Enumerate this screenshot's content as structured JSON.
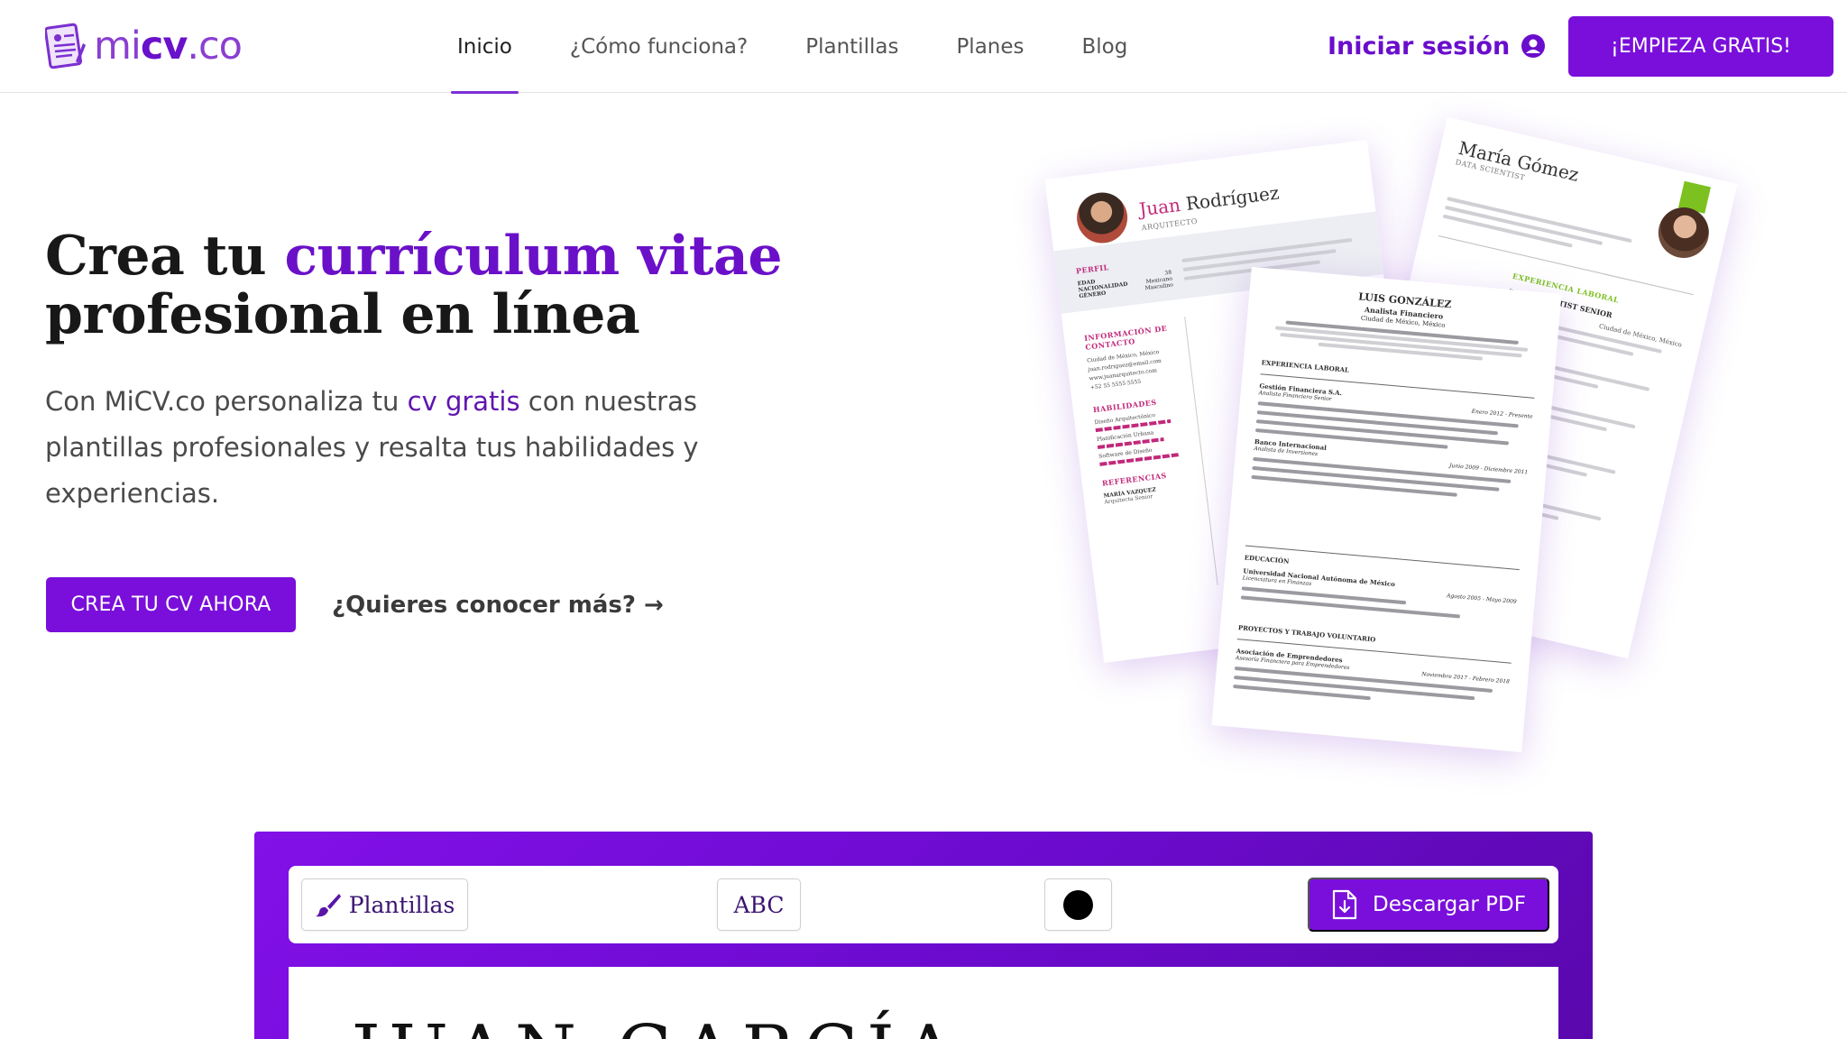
{
  "brand": {
    "logo_regular_1": "mi",
    "logo_bold": "cv",
    "logo_regular_2": ".co",
    "primary_color": "#7a0fdb",
    "accent_color": "#6b10c9"
  },
  "nav": {
    "items": [
      {
        "label": "Inicio",
        "active": true
      },
      {
        "label": "¿Cómo funciona?",
        "active": false
      },
      {
        "label": "Plantillas",
        "active": false
      },
      {
        "label": "Planes",
        "active": false
      },
      {
        "label": "Blog",
        "active": false
      }
    ],
    "login_label": "Iniciar sesión",
    "login_icon": "user-circle-icon",
    "cta_label": "¡EMPIEZA GRATIS!"
  },
  "hero": {
    "title_part1": "Crea tu ",
    "title_accent": "currículum vitae",
    "title_part2": "profesional en línea",
    "subtitle_part1": "Con MiCV.co personaliza tu ",
    "subtitle_link": "cv gratis",
    "subtitle_part2": " con nuestras plantillas profesionales y resalta tus habilidades y experiencias.",
    "primary_button": "CREA TU CV AHORA",
    "secondary_link": "¿Quieres conocer más? →"
  },
  "cv_previews": {
    "juan": {
      "first_name": "Juan",
      "last_name": "Rodríguez",
      "role": "ARQUITECTO",
      "sections": [
        "PERFIL",
        "INFORMACIÓN DE CONTACTO",
        "HABILIDADES",
        "REFERENCIAS"
      ],
      "profile_rows": [
        {
          "label": "EDAD",
          "value": "38"
        },
        {
          "label": "NACIONALIDAD",
          "value": "Mexicano"
        },
        {
          "label": "GÉNERO",
          "value": "Masculino"
        }
      ],
      "contact": [
        "Ciudad de México, México",
        "juan.rodriguez@email.com",
        "www.juanarquitecto.com",
        "+52 55 5555 5555"
      ],
      "skills": [
        "Diseño Arquitectónico",
        "Planificación Urbana",
        "Software de Diseño"
      ],
      "reference_name": "MARÍA VAZQUEZ",
      "reference_role": "Arquitecta Senior",
      "accent_color": "#c2297a"
    },
    "maria": {
      "name": "María Gómez",
      "role": "DATA SCIENTIST",
      "section": "EXPERIENCIA LABORAL",
      "job": "DATA SCIENTIST SENIOR",
      "location": "Ciudad de México, México",
      "accent_color": "#7cc11f"
    },
    "luis": {
      "name": "LUIS GONZÁLEZ",
      "role": "Analista Financiero",
      "location": "Ciudad de México, México",
      "sections": [
        "EXPERIENCIA LABORAL",
        "EDUCACIÓN",
        "PROYECTOS Y TRABAJO VOLUNTARIO"
      ],
      "jobs": [
        {
          "company": "Gestión Financiera S.A.",
          "title": "Analista Financiero Senior",
          "dates": "Enero 2012 - Presente"
        },
        {
          "company": "Banco Internacional",
          "title": "Analista de Inversiones",
          "dates": "Junio 2009 - Diciembre 2011"
        }
      ],
      "education": {
        "school": "Universidad Nacional Autónoma de México",
        "degree": "Licenciatura en Finanzas",
        "dates": "Agosto 2005 - Mayo 2009"
      },
      "project": {
        "name": "Asociación de Emprendedores",
        "role": "Asesoría Financiera para Emprendedores",
        "dates": "Noviembre 2017 - Febrero 2018"
      }
    }
  },
  "editor": {
    "templates_button": "Plantillas",
    "templates_icon": "paintbrush-icon",
    "font_button": "ABC",
    "color_value": "#000000",
    "download_button": "Descargar PDF",
    "download_icon": "file-download-icon",
    "preview_name": "JUAN GARCÍA"
  }
}
